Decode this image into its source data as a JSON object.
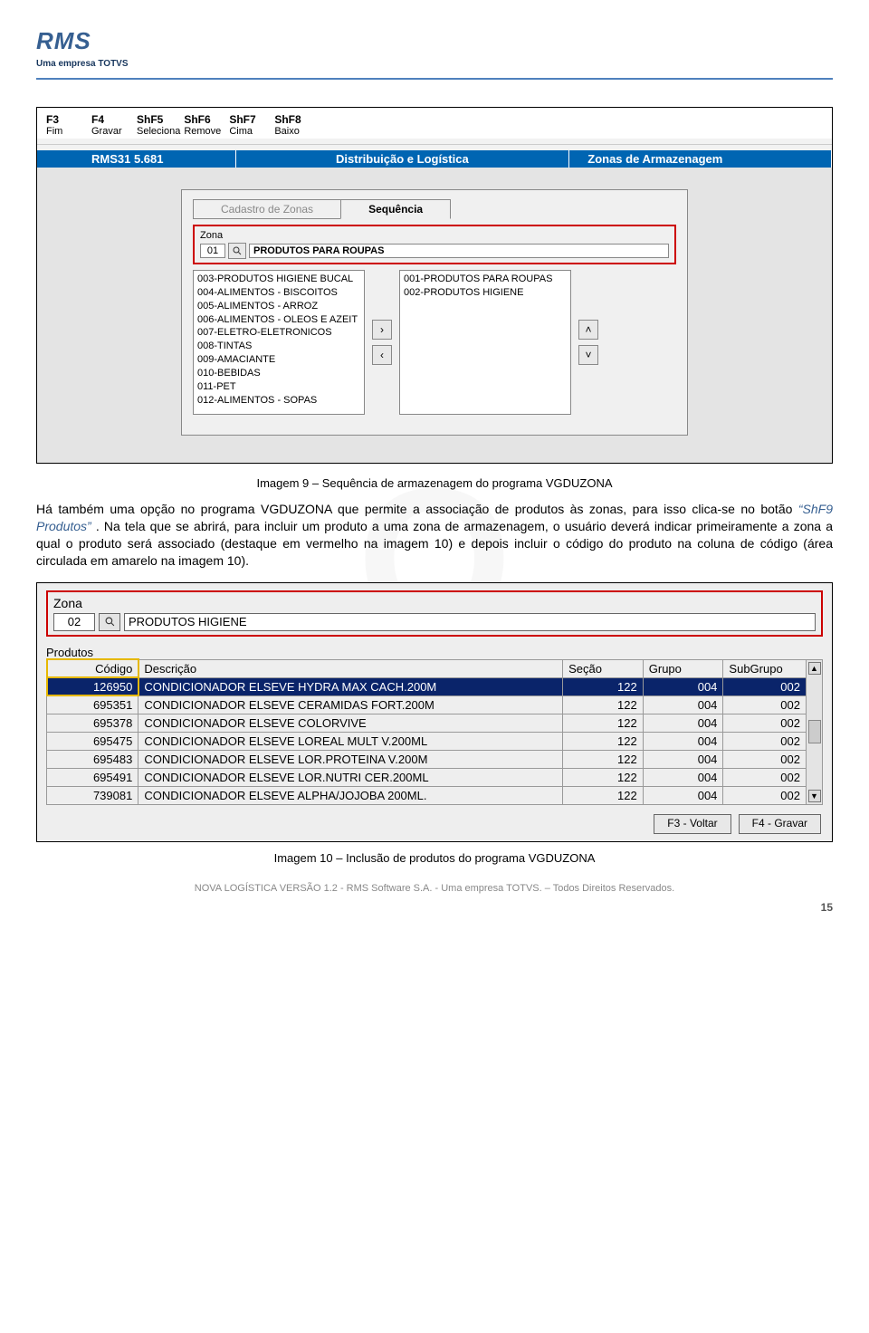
{
  "logo": {
    "name": "RMS",
    "sub": "Uma empresa TOTVS"
  },
  "sc1": {
    "toolbar": [
      {
        "k": "F3",
        "l": "Fim"
      },
      {
        "k": "F4",
        "l": "Gravar"
      },
      {
        "k": "ShF5",
        "l": "Seleciona"
      },
      {
        "k": "ShF6",
        "l": "Remove"
      },
      {
        "k": "ShF7",
        "l": "Cima"
      },
      {
        "k": "ShF8",
        "l": "Baixo"
      }
    ],
    "ribbon": {
      "r1": "RMS31 5.681",
      "r2": "Distribuição e Logística",
      "r3": "Zonas de Armazenagem"
    },
    "tabs": {
      "inactive": "Cadastro de Zonas",
      "active": "Sequência"
    },
    "zone_label": "Zona",
    "zone_code": "01",
    "zone_desc": "PRODUTOS PARA ROUPAS",
    "list_left": [
      "003-PRODUTOS HIGIENE BUCAL",
      "004-ALIMENTOS - BISCOITOS",
      "005-ALIMENTOS - ARROZ",
      "006-ALIMENTOS - OLEOS E AZEIT",
      "007-ELETRO-ELETRONICOS",
      "008-TINTAS",
      "009-AMACIANTE",
      "010-BEBIDAS",
      "011-PET",
      "012-ALIMENTOS - SOPAS"
    ],
    "list_right": [
      "001-PRODUTOS PARA ROUPAS",
      "002-PRODUTOS HIGIENE"
    ]
  },
  "caption1": "Imagem 9 – Sequência de armazenagem do programa VGDUZONA",
  "para1a": "Há também uma opção no programa VGDUZONA que permite a associação de produtos às zonas, para isso clica-se no botão ",
  "para1link": "ShF9 Produtos",
  "para1b": ". Na tela que se abrirá, para incluir um produto a uma zona de armazenagem, o usuário deverá indicar primeiramente a zona a qual o produto será associado (destaque em vermelho na imagem 10) e depois incluir o código do produto na coluna de código (área circulada em amarelo na imagem 10).",
  "sc2": {
    "zone_label": "Zona",
    "zone_code": "02",
    "zone_desc": "PRODUTOS HIGIENE",
    "prods_label": "Produtos",
    "headers": {
      "codigo": "Código",
      "desc": "Descrição",
      "secao": "Seção",
      "grupo": "Grupo",
      "subgrupo": "SubGrupo"
    },
    "rows": [
      {
        "c": "126950",
        "d": "CONDICIONADOR ELSEVE HYDRA MAX CACH.200M",
        "s": "122",
        "g": "004",
        "sg": "002"
      },
      {
        "c": "695351",
        "d": "CONDICIONADOR ELSEVE CERAMIDAS FORT.200M",
        "s": "122",
        "g": "004",
        "sg": "002"
      },
      {
        "c": "695378",
        "d": "CONDICIONADOR ELSEVE COLORVIVE",
        "s": "122",
        "g": "004",
        "sg": "002"
      },
      {
        "c": "695475",
        "d": "CONDICIONADOR ELSEVE LOREAL MULT V.200ML",
        "s": "122",
        "g": "004",
        "sg": "002"
      },
      {
        "c": "695483",
        "d": "CONDICIONADOR ELSEVE LOR.PROTEINA V.200M",
        "s": "122",
        "g": "004",
        "sg": "002"
      },
      {
        "c": "695491",
        "d": "CONDICIONADOR ELSEVE LOR.NUTRI CER.200ML",
        "s": "122",
        "g": "004",
        "sg": "002"
      },
      {
        "c": "739081",
        "d": "CONDICIONADOR ELSEVE ALPHA/JOJOBA 200ML.",
        "s": "122",
        "g": "004",
        "sg": "002"
      }
    ],
    "btn_back": "F3 - Voltar",
    "btn_save": "F4 - Gravar"
  },
  "caption2": "Imagem 10 – Inclusão de produtos do programa VGDUZONA",
  "footer": "NOVA LOGÍSTICA VERSÃO 1.2 - RMS Software S.A. - Uma empresa TOTVS. – Todos Direitos Reservados.",
  "page_num": "15"
}
